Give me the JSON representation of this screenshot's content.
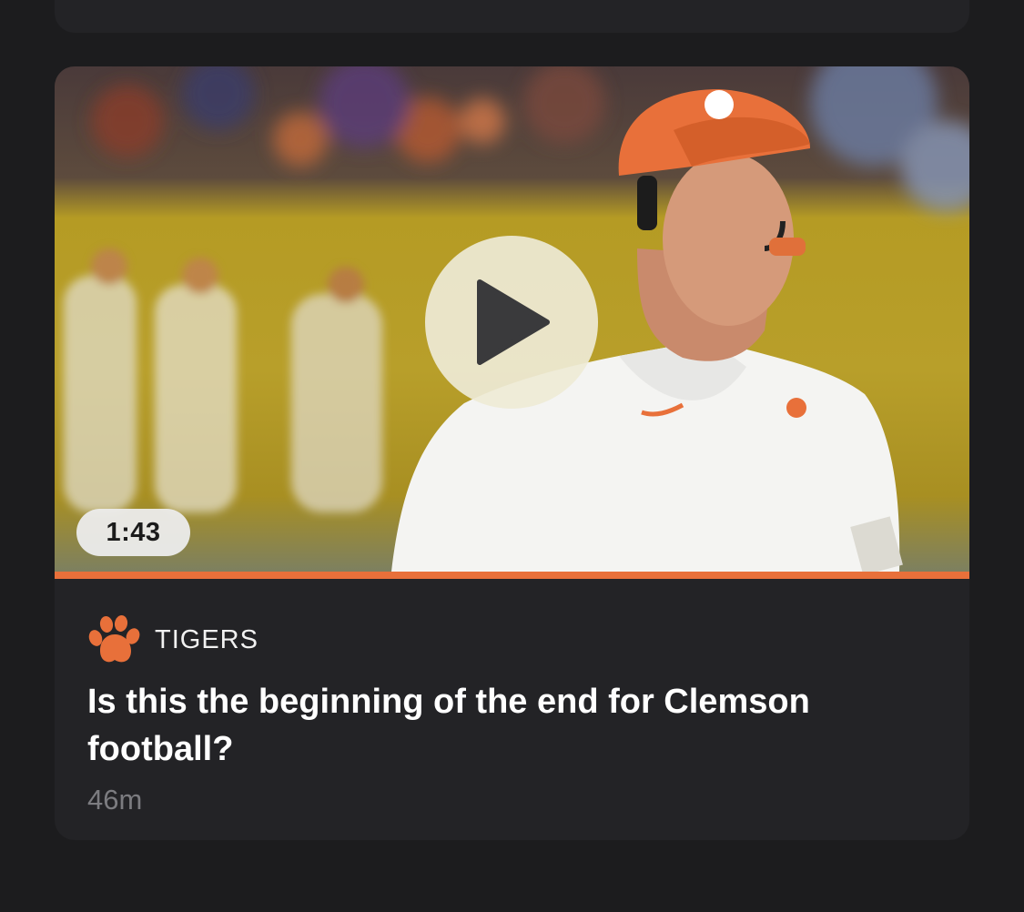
{
  "card": {
    "team": "TIGERS",
    "headline": "Is this the beginning of the end for Clemson football?",
    "timestamp": "46m",
    "video": {
      "duration": "1:43",
      "progress": 1.0
    },
    "team_color": "#e8703a"
  }
}
